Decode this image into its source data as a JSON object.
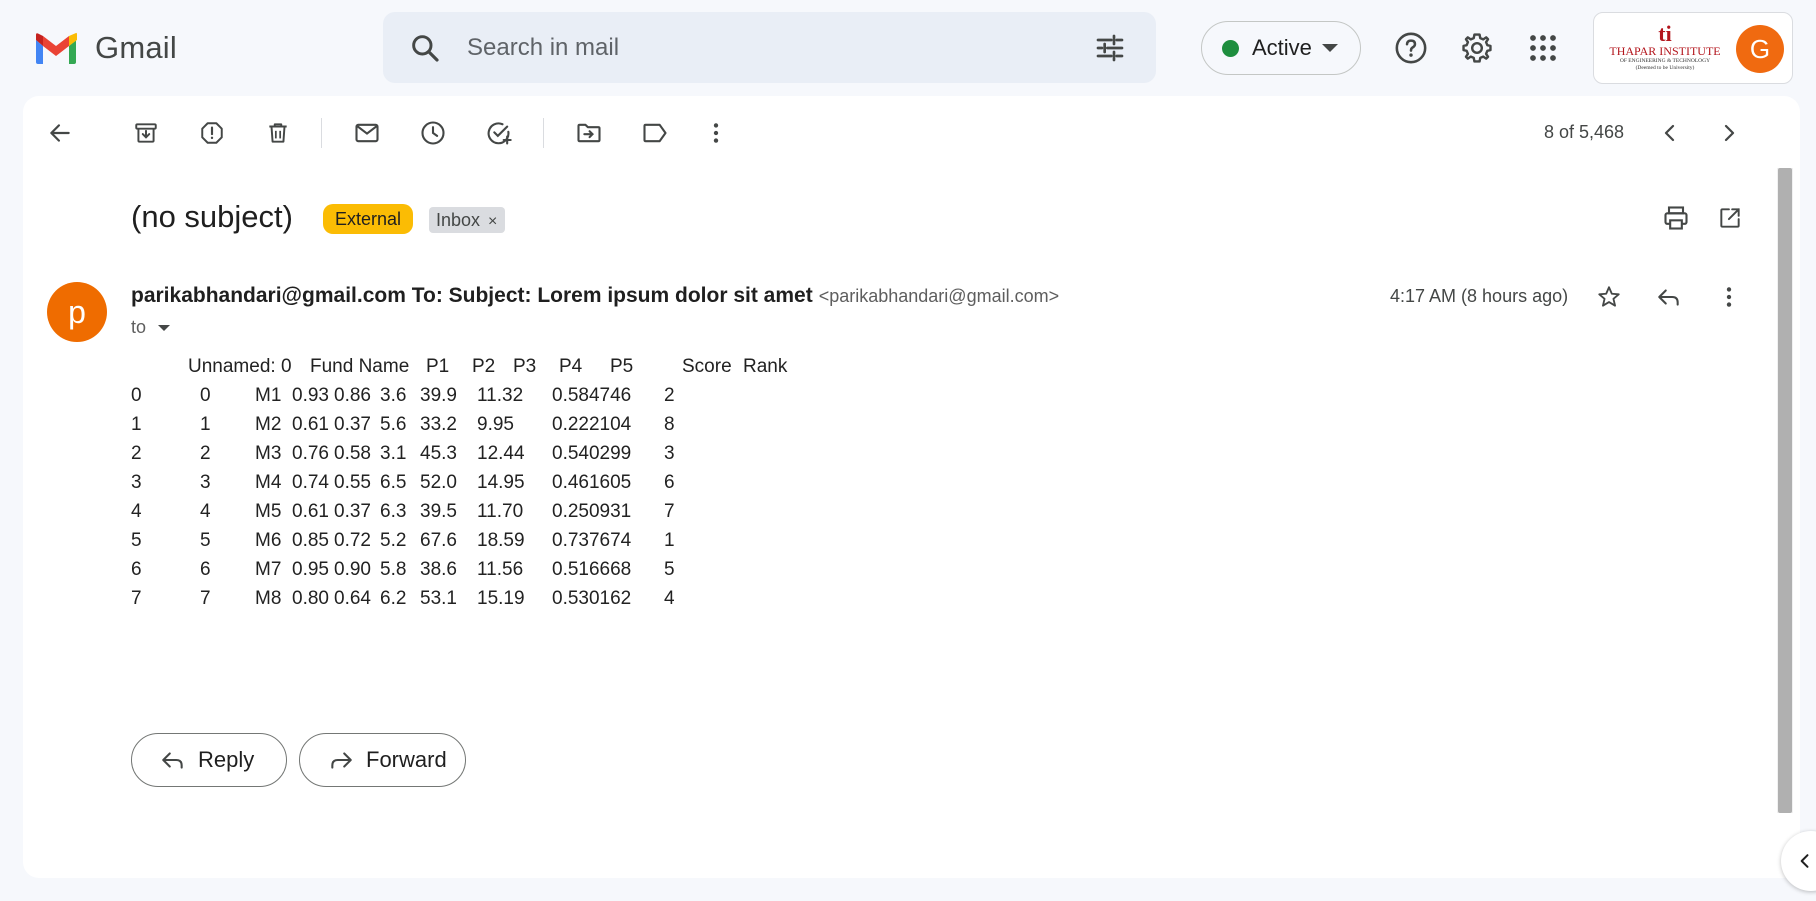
{
  "app": {
    "name": "Gmail",
    "brand_colors": [
      "#4285f4",
      "#ea4335",
      "#fbbc04",
      "#34a853",
      "#c5221f"
    ]
  },
  "search": {
    "placeholder": "Search in mail"
  },
  "status": {
    "label": "Active",
    "color": "#1e8e3e"
  },
  "header_icons": [
    "search-icon",
    "filter-icon",
    "help-icon",
    "gear-icon",
    "apps-icon"
  ],
  "account": {
    "org_mark": "ti",
    "org_name": "THAPAR INSTITUTE",
    "org_sub1": "OF ENGINEERING & TECHNOLOGY",
    "org_sub2": "(Deemed to be University)",
    "avatar_letter": "G",
    "avatar_color": "#f06a10"
  },
  "toolbar": {
    "icons": [
      "back-arrow-icon",
      "archive-icon",
      "report-spam-icon",
      "delete-icon",
      "mark-unread-icon",
      "snooze-icon",
      "add-to-tasks-icon",
      "move-to-icon",
      "label-icon",
      "more-vert-icon"
    ],
    "pager": "8 of 5,468"
  },
  "email": {
    "subject": "(no subject)",
    "labels": {
      "external": "External",
      "inbox": "Inbox",
      "remove": "×"
    },
    "sender_avatar": "p",
    "sender_name": "parikabhandari@gmail.com To: Subject: Lorem ipsum dolor sit amet",
    "sender_email": "<parikabhandari@gmail.com>",
    "to": "to",
    "time": "4:17 AM (8 hours ago)",
    "table": {
      "headers": [
        "Unnamed: 0",
        "Fund Name",
        "P1",
        "P2",
        "P3",
        "P4",
        "P5",
        "Score",
        "Rank"
      ],
      "rows": [
        [
          "0",
          "0",
          "M1",
          "0.93",
          "0.86",
          "3.6",
          "39.9",
          "11.32",
          "0.584746",
          "2"
        ],
        [
          "1",
          "1",
          "M2",
          "0.61",
          "0.37",
          "5.6",
          "33.2",
          "9.95",
          "0.222104",
          "8"
        ],
        [
          "2",
          "2",
          "M3",
          "0.76",
          "0.58",
          "3.1",
          "45.3",
          "12.44",
          "0.540299",
          "3"
        ],
        [
          "3",
          "3",
          "M4",
          "0.74",
          "0.55",
          "6.5",
          "52.0",
          "14.95",
          "0.461605",
          "6"
        ],
        [
          "4",
          "4",
          "M5",
          "0.61",
          "0.37",
          "6.3",
          "39.5",
          "11.70",
          "0.250931",
          "7"
        ],
        [
          "5",
          "5",
          "M6",
          "0.85",
          "0.72",
          "5.2",
          "67.6",
          "18.59",
          "0.737674",
          "1"
        ],
        [
          "6",
          "6",
          "M7",
          "0.95",
          "0.90",
          "5.8",
          "38.6",
          "11.56",
          "0.516668",
          "5"
        ],
        [
          "7",
          "7",
          "M8",
          "0.80",
          "0.64",
          "6.2",
          "53.1",
          "15.19",
          "0.530162",
          "4"
        ]
      ]
    }
  },
  "actions": {
    "reply": "Reply",
    "forward": "Forward"
  }
}
